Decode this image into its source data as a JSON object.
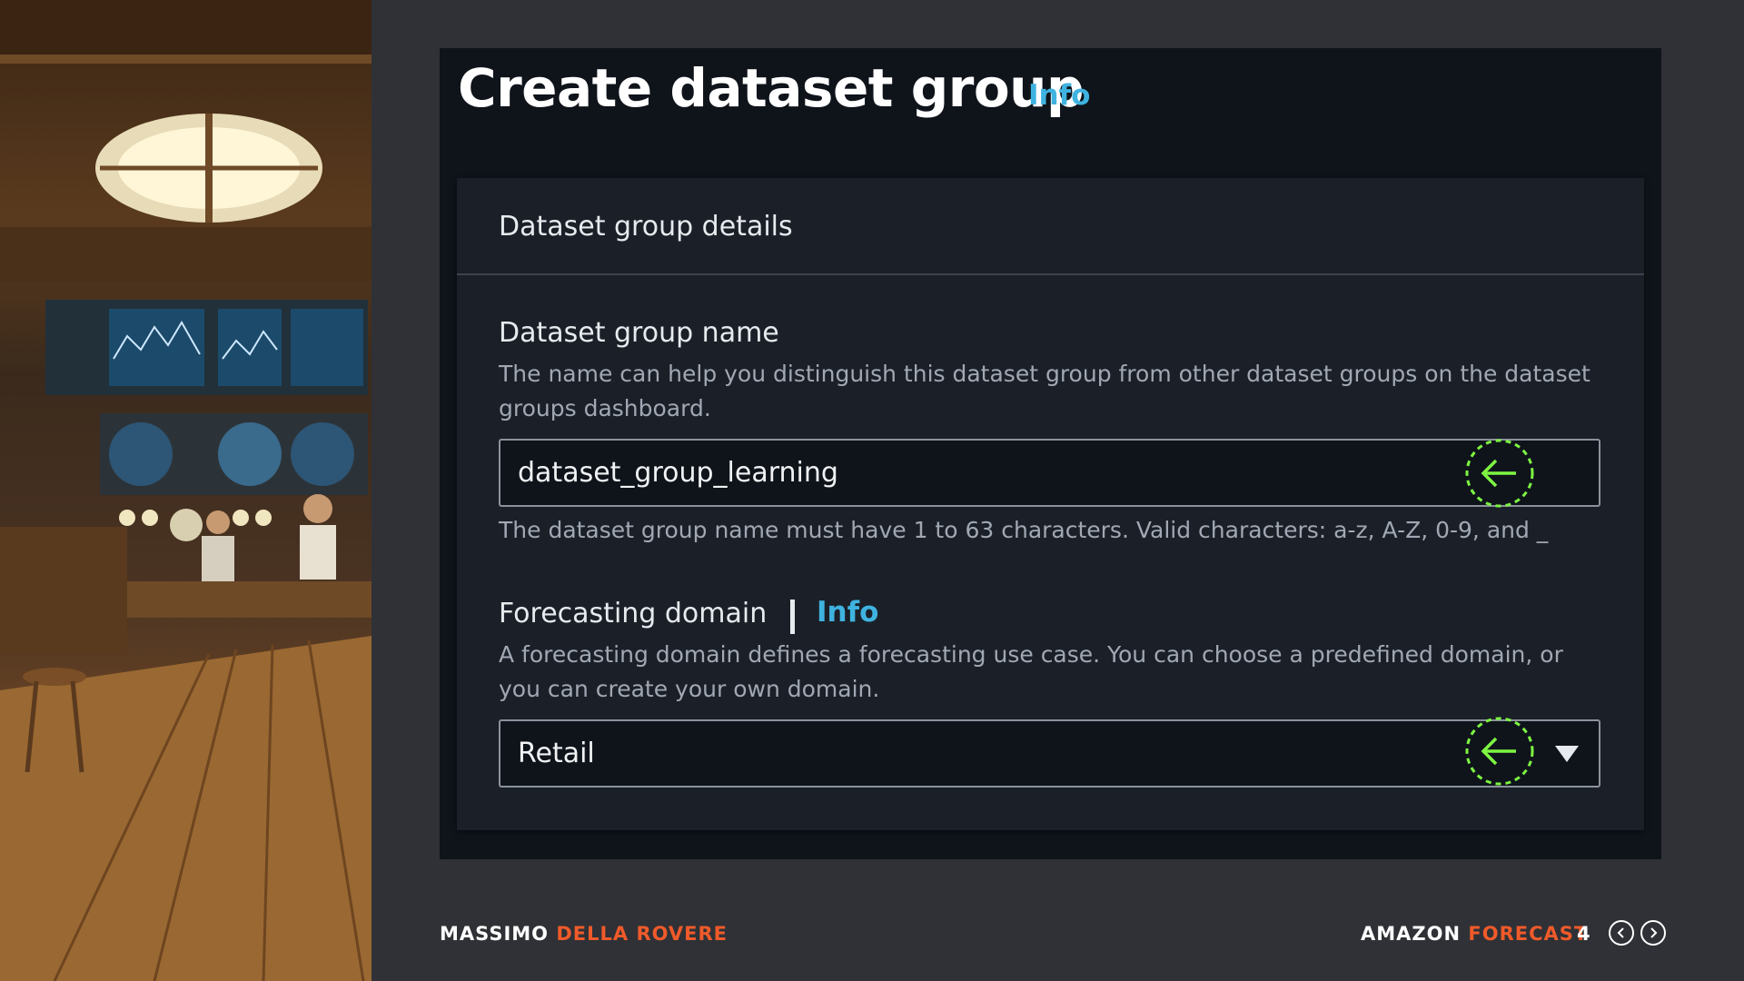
{
  "page": {
    "title": "Create dataset group",
    "title_info": "Info"
  },
  "card": {
    "header": "Dataset group details",
    "name_field": {
      "label": "Dataset group name",
      "description": "The name can help you distinguish this dataset group from other dataset groups on the dataset groups dashboard.",
      "value": "dataset_group_learning",
      "constraint": "The dataset group name must have 1 to 63 characters. Valid characters: a-z, A-Z, 0-9, and _"
    },
    "domain_field": {
      "label": "Forecasting domain",
      "info": "Info",
      "description": "A forecasting domain defines a forecasting use case. You can choose a predefined domain, or you can create your own domain.",
      "selected": "Retail"
    }
  },
  "footer": {
    "author_first": "MASSIMO",
    "author_last": "DELLA ROVERE",
    "product_first": "AMAZON",
    "product_last": "FORECAST",
    "page_number": "4"
  },
  "colors": {
    "accent": "#f05a2a",
    "info_link": "#3fb3e0",
    "marker": "#7ef542"
  },
  "icons": [
    "left-arrow-marker-icon",
    "caret-down-icon",
    "chevron-left-icon",
    "chevron-right-icon"
  ]
}
